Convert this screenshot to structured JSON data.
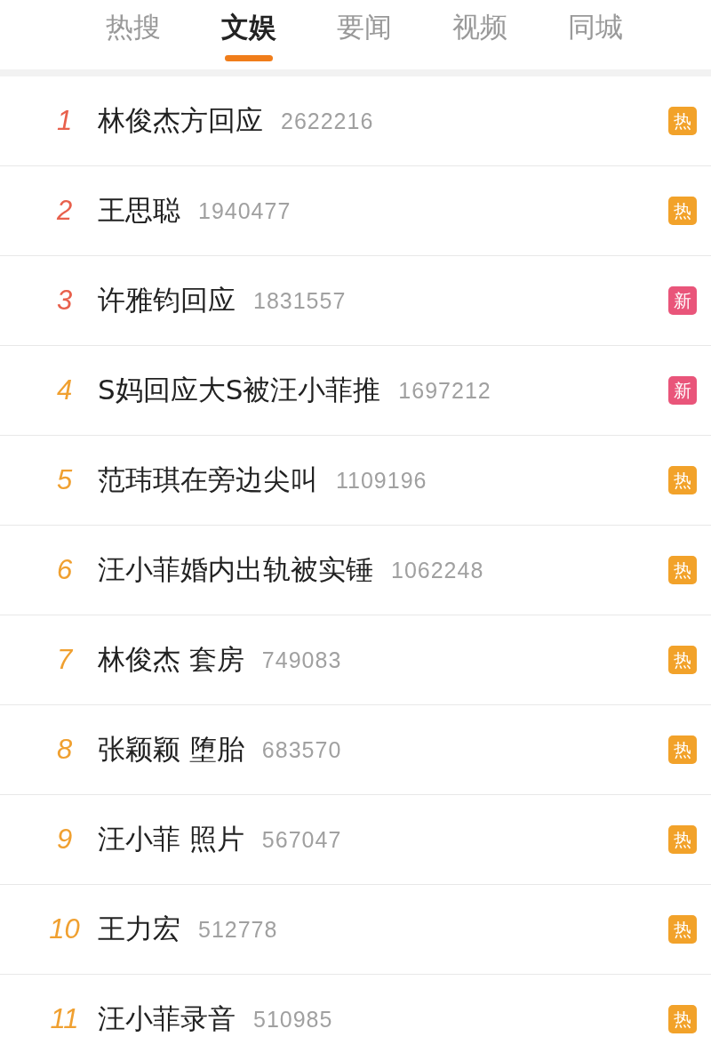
{
  "tabs": [
    {
      "label": "热搜",
      "selected": false
    },
    {
      "label": "文娱",
      "selected": true
    },
    {
      "label": "要闻",
      "selected": false
    },
    {
      "label": "视频",
      "selected": false
    },
    {
      "label": "同城",
      "selected": false
    }
  ],
  "rows": [
    {
      "rank": "1",
      "color": "#e8604c",
      "title": "林俊杰方回应",
      "count": "2622216",
      "badge": {
        "kind": "hot",
        "label": "热"
      }
    },
    {
      "rank": "2",
      "color": "#e8604c",
      "title": "王思聪",
      "count": "1940477",
      "badge": {
        "kind": "hot",
        "label": "热"
      }
    },
    {
      "rank": "3",
      "color": "#e8604c",
      "title": "许雅钧回应",
      "count": "1831557",
      "badge": {
        "kind": "new",
        "label": "新"
      }
    },
    {
      "rank": "4",
      "color": "#f0a030",
      "title": "S妈回应大S被汪小菲推",
      "count": "1697212",
      "badge": {
        "kind": "new",
        "label": "新"
      }
    },
    {
      "rank": "5",
      "color": "#f0a030",
      "title": "范玮琪在旁边尖叫",
      "count": "1109196",
      "badge": {
        "kind": "hot",
        "label": "热"
      }
    },
    {
      "rank": "6",
      "color": "#f0a030",
      "title": "汪小菲婚内出轨被实锤",
      "count": "1062248",
      "badge": {
        "kind": "hot",
        "label": "热"
      }
    },
    {
      "rank": "7",
      "color": "#f0a030",
      "title": "林俊杰 套房",
      "count": "749083",
      "badge": {
        "kind": "hot",
        "label": "热"
      }
    },
    {
      "rank": "8",
      "color": "#f0a030",
      "title": "张颖颖 堕胎",
      "count": "683570",
      "badge": {
        "kind": "hot",
        "label": "热"
      }
    },
    {
      "rank": "9",
      "color": "#f0a030",
      "title": "汪小菲 照片",
      "count": "567047",
      "badge": {
        "kind": "hot",
        "label": "热"
      }
    },
    {
      "rank": "10",
      "color": "#f0a030",
      "title": "王力宏",
      "count": "512778",
      "badge": {
        "kind": "hot",
        "label": "热"
      }
    },
    {
      "rank": "11",
      "color": "#f0a030",
      "title": "汪小菲录音",
      "count": "510985",
      "badge": {
        "kind": "hot",
        "label": "热"
      }
    }
  ]
}
